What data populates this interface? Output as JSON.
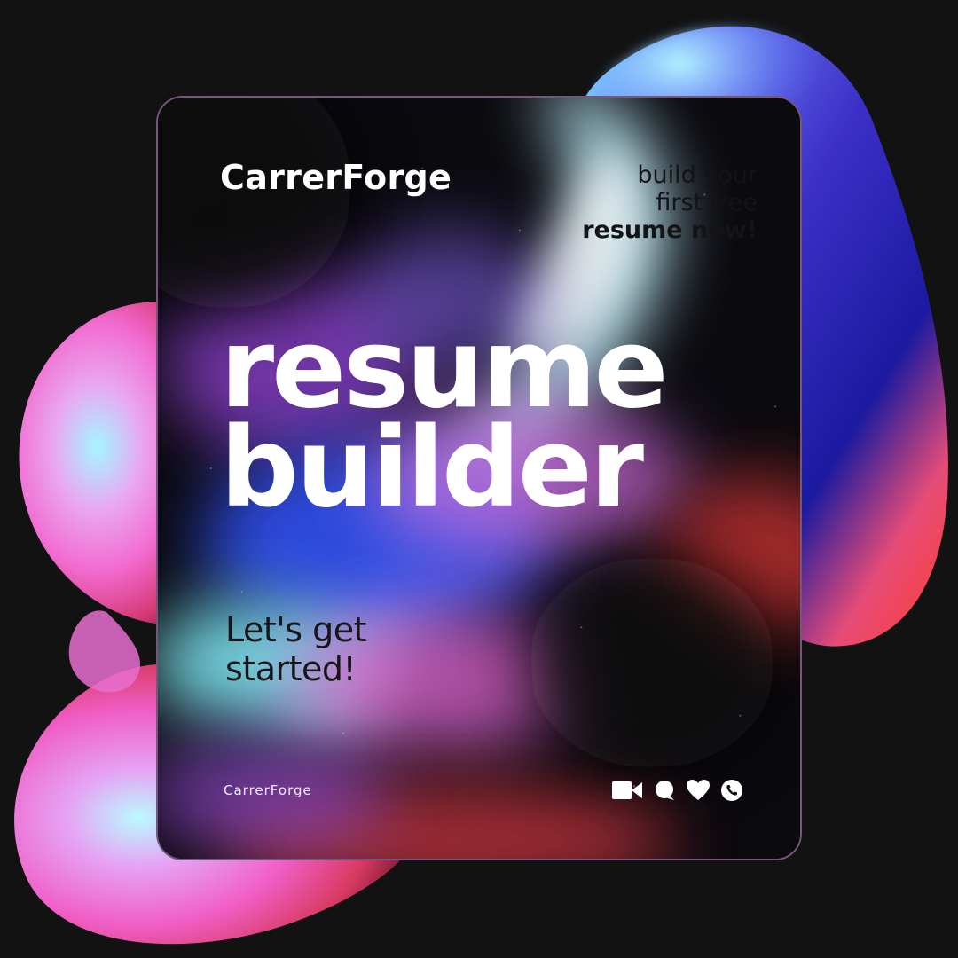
{
  "brand": {
    "name": "CarrerForge"
  },
  "tagline": {
    "line1": "build your",
    "line2": "first free",
    "line3": "resume now!"
  },
  "headline": {
    "line1": "resume",
    "line2": "builder"
  },
  "cta": {
    "line1": "Let's get",
    "line2": "started!"
  },
  "footer": {
    "brand": "CarrerForge",
    "icons": [
      "video-camera-icon",
      "chat-bubble-icon",
      "heart-icon",
      "phone-icon"
    ]
  },
  "colors": {
    "background": "#121212",
    "pink": "#ff6fd8",
    "cyan": "#9ff4f0",
    "blue": "#3f58e8",
    "red": "#e8343c",
    "text_light": "#ffffff",
    "text_dark": "#141316"
  }
}
